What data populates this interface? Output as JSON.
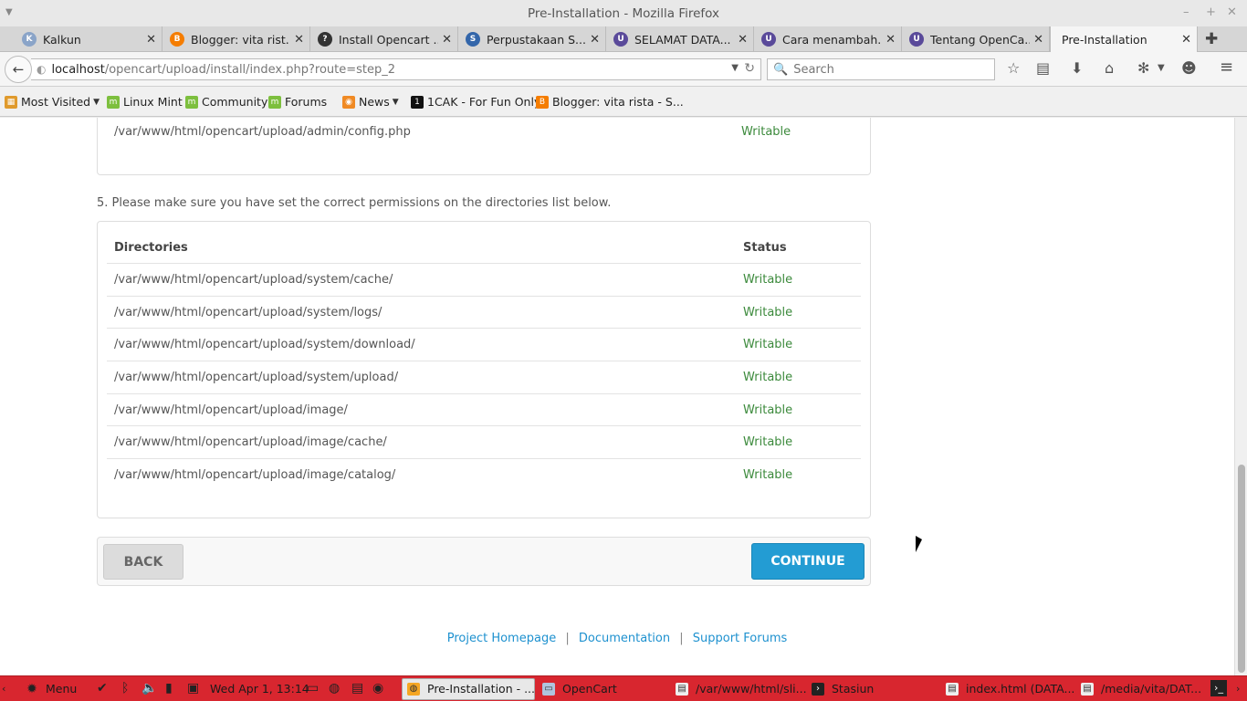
{
  "window": {
    "title": "Pre-Installation - Mozilla Firefox"
  },
  "tabs": [
    {
      "label": "Kalkun",
      "icon_color": "#8aa4c8",
      "icon_glyph": "K"
    },
    {
      "label": "Blogger: vita rist...",
      "icon_color": "#f57d00",
      "icon_glyph": "B"
    },
    {
      "label": "Install Opencart ...",
      "icon_color": "#333333",
      "icon_glyph": "?"
    },
    {
      "label": "Perpustakaan S...",
      "icon_color": "#3366aa",
      "icon_glyph": "S"
    },
    {
      "label": "SELAMAT DATA...",
      "icon_color": "#5a4a9a",
      "icon_glyph": "U"
    },
    {
      "label": "Cara menambah...",
      "icon_color": "#5a4a9a",
      "icon_glyph": "U"
    },
    {
      "label": "Tentang OpenCa...",
      "icon_color": "#5a4a9a",
      "icon_glyph": "U"
    },
    {
      "label": "Pre-Installation",
      "icon_color": "",
      "icon_glyph": ""
    }
  ],
  "nav": {
    "url_host": "localhost",
    "url_path": "/opencart/upload/install/index.php?route=step_2",
    "search_placeholder": "Search"
  },
  "bookmarks": [
    {
      "label": "Most Visited",
      "has_caret": true
    },
    {
      "label": "Linux Mint"
    },
    {
      "label": "Community"
    },
    {
      "label": "Forums"
    },
    {
      "label": "News",
      "has_caret": true
    },
    {
      "label": "1CAK - For Fun Only"
    },
    {
      "label": "Blogger: vita rista - S..."
    }
  ],
  "files_panel": {
    "last_file": "/var/www/html/opencart/upload/admin/config.php",
    "last_status": "Writable"
  },
  "instruction": "5. Please make sure you have set the correct permissions on the directories list below.",
  "directories": {
    "header_dir": "Directories",
    "header_status": "Status",
    "rows": [
      {
        "path": "/var/www/html/opencart/upload/system/cache/",
        "status": "Writable"
      },
      {
        "path": "/var/www/html/opencart/upload/system/logs/",
        "status": "Writable"
      },
      {
        "path": "/var/www/html/opencart/upload/system/download/",
        "status": "Writable"
      },
      {
        "path": "/var/www/html/opencart/upload/system/upload/",
        "status": "Writable"
      },
      {
        "path": "/var/www/html/opencart/upload/image/",
        "status": "Writable"
      },
      {
        "path": "/var/www/html/opencart/upload/image/cache/",
        "status": "Writable"
      },
      {
        "path": "/var/www/html/opencart/upload/image/catalog/",
        "status": "Writable"
      }
    ]
  },
  "buttons": {
    "back": "BACK",
    "continue": "CONTINUE"
  },
  "footer": {
    "project_homepage": "Project Homepage",
    "sep": "|",
    "documentation": "Documentation",
    "support_forums": "Support Forums"
  },
  "taskbar": {
    "menu": "Menu",
    "clock": "Wed Apr  1, 13:14",
    "items": [
      {
        "label": "Pre-Installation - ..."
      },
      {
        "label": "OpenCart"
      },
      {
        "label": "/var/www/html/sli..."
      },
      {
        "label": "Stasiun"
      },
      {
        "label": "index.html (DATA..."
      },
      {
        "label": "/media/vita/DAT..."
      }
    ]
  },
  "colors": {
    "writable": "#3c8a3c",
    "link": "#1e91cf",
    "continue_bg": "#239cd3",
    "taskbar_bg": "#d8262f"
  }
}
